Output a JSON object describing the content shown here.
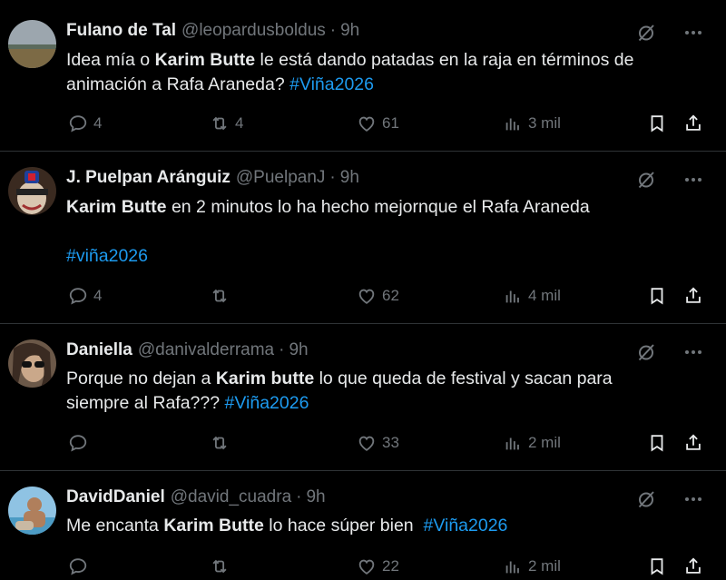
{
  "colors": {
    "background": "#000000",
    "text": "#e7e9ea",
    "muted": "#71767b",
    "hashtag": "#1d9bf0",
    "divider": "#2f3336"
  },
  "icons": {
    "reply": "reply-icon",
    "retweet": "retweet-icon",
    "like": "heart-icon",
    "views": "views-icon",
    "bookmark": "bookmark-icon",
    "share": "share-icon",
    "grok": "grok-icon",
    "more": "more-icon"
  },
  "tweets": [
    {
      "name": "Fulano de Tal",
      "handle": "@leopardusboldus",
      "dot": "·",
      "time": "9h",
      "line1": {
        "pre": "Idea mía o ",
        "bold": "Karim Butte",
        "post": " le está dando patadas en la raja en términos de"
      },
      "line2": {
        "pre": "animación a Rafa Araneda? ",
        "hashtag": "#Viña2026"
      },
      "replies": "4",
      "retweets": "4",
      "likes": "61",
      "views": "3 mil"
    },
    {
      "name": "J. Puelpan Aránguiz",
      "handle": "@PuelpanJ",
      "dot": "·",
      "time": "9h",
      "line1": {
        "bold": "Karim Butte",
        "post": " en 2 minutos lo ha hecho mejornque el Rafa Araneda"
      },
      "line2": {
        "hashtag": "#viña2026"
      },
      "replies": "4",
      "retweets": "",
      "likes": "62",
      "views": "4 mil"
    },
    {
      "name": "Daniella",
      "handle": "@danivalderrama",
      "dot": "·",
      "time": "9h",
      "line1": {
        "pre": "Porque no dejan a ",
        "bold": "Karim butte",
        "post": " lo que queda de festival y sacan para"
      },
      "line2": {
        "pre": "siempre al Rafa??? ",
        "hashtag": "#Viña2026"
      },
      "replies": "",
      "retweets": "",
      "likes": "33",
      "views": "2 mil"
    },
    {
      "name": "DavidDaniel",
      "handle": "@david_cuadra",
      "dot": "·",
      "time": "9h",
      "line1": {
        "pre": "Me encanta ",
        "bold": "Karim Butte",
        "post": " lo hace súper bien  ",
        "hashtag": "#Viña2026"
      },
      "replies": "",
      "retweets": "",
      "likes": "22",
      "views": "2 mil"
    }
  ]
}
